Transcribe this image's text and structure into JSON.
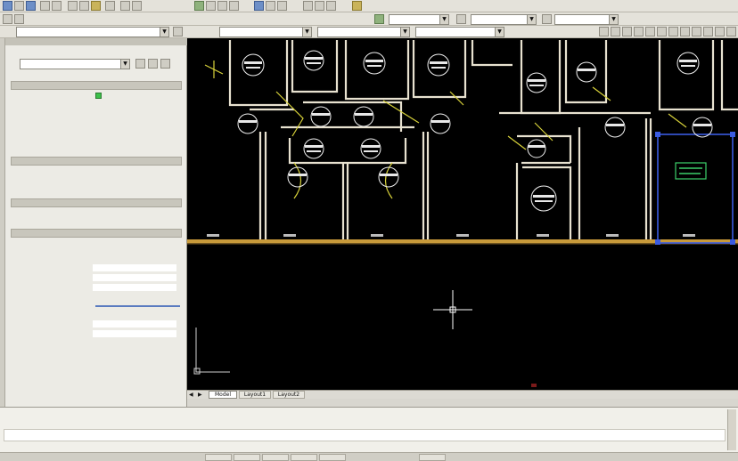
{
  "toolbar2": {
    "layer_combo": "",
    "style_combo": "",
    "scale_combo": "",
    "color_combo": "",
    "lineweight_combo": "",
    "plot_combo": ""
  },
  "properties": {
    "object_combo": "",
    "sections": [
      "",
      "",
      "",
      ""
    ],
    "rows": [
      {
        "k": "",
        "v": ""
      },
      {
        "k": "",
        "v": ""
      },
      {
        "k": "",
        "v": ""
      },
      {
        "k": "",
        "v": ""
      },
      {
        "k": "",
        "v": ""
      },
      {
        "k": "",
        "v": ""
      },
      {
        "k": "",
        "v": ""
      },
      {
        "k": "",
        "v": ""
      }
    ],
    "selected_row": {
      "k": "",
      "v": ""
    },
    "footer": ""
  },
  "drawing": {
    "rooms": [
      {
        "label": ""
      },
      {
        "label": ""
      },
      {
        "label": ""
      },
      {
        "label": ""
      }
    ],
    "line_color": "#e8e2d0",
    "accent_yellow": "#d8d23a",
    "accent_blue": "#3a5be0",
    "accent_green": "#3cd06a",
    "floor_color": "#c89a3a"
  },
  "layout_tabs": [
    "Model",
    "Layout1",
    "Layout2"
  ],
  "command": {
    "line1": "",
    "line2": ""
  },
  "status": {
    "coords": ""
  }
}
